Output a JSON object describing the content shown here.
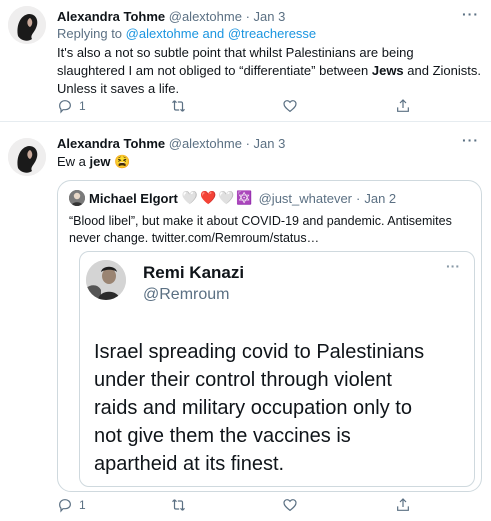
{
  "tweet1": {
    "author_name": "Alexandra Tohme",
    "handle": "@alextohme",
    "separator": "·",
    "date": "Jan 3",
    "more": "···",
    "reply_prefix": "Replying to",
    "reply_to_1": "@alextohme",
    "reply_and": "and",
    "reply_to_2": "@treacheresse",
    "body_part1": "It's also a not so subtle point that whilst Palestinians are being slaughtered I am not obliged to “differentiate” between ",
    "body_bold": "Jews",
    "body_part2": " and Zionists. Unless it saves a life.",
    "reply_count": "1",
    "retweet_count": "",
    "like_count": ""
  },
  "tweet2": {
    "author_name": "Alexandra Tohme",
    "handle": "@alextohme",
    "separator": "·",
    "date": "Jan 3",
    "more": "···",
    "body_prefix": "Ew a ",
    "body_bold": "jew",
    "body_emoji": "😫",
    "reply_count": "1",
    "retweet_count": "",
    "like_count": ""
  },
  "quote": {
    "author_name": "Michael Elgort",
    "emojis": [
      "🤍",
      "❤️",
      "🤍",
      "🔯"
    ],
    "handle": "@just_whatever",
    "separator": "·",
    "date": "Jan 2",
    "text": "“Blood libel”, but make it about COVID-19 and pandemic. Antisemites never change.  twitter.com/Remroum/status…"
  },
  "inner_tweet": {
    "author_name": "Remi Kanazi",
    "handle": "@Remroum",
    "more": "···",
    "lines": [
      "Israel spreading covid to Palestinians",
      "under their control through violent",
      "raids and military occupation only to",
      "not give them the vaccines is",
      "apartheid at its finest."
    ]
  },
  "colors": {
    "text": "#0f1419",
    "secondary": "#5b7083",
    "link": "#1b95e0",
    "border": "#cfd9de"
  },
  "icons": [
    "reply-icon",
    "retweet-icon",
    "like-icon",
    "share-icon",
    "more-icon"
  ]
}
